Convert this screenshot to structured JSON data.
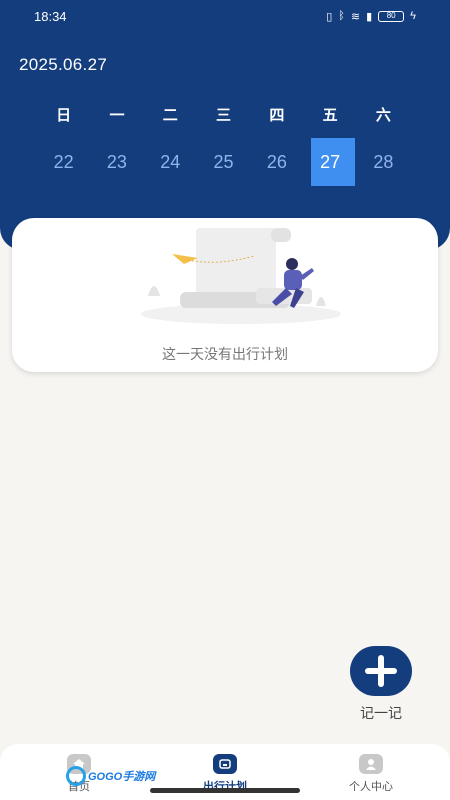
{
  "status_bar": {
    "time": "18:34",
    "battery": "80"
  },
  "header": {
    "date": "2025.06.27",
    "weekdays": [
      "日",
      "一",
      "二",
      "三",
      "四",
      "五",
      "六"
    ],
    "days": [
      "22",
      "23",
      "24",
      "25",
      "26",
      "27",
      "28"
    ],
    "selected_day": "27"
  },
  "card": {
    "empty_text": "这一天没有出行计划"
  },
  "fab": {
    "label": "记一记"
  },
  "tabbar": {
    "tabs": [
      {
        "label": "首页",
        "icon": "home-icon"
      },
      {
        "label": "出行计划",
        "icon": "plan-icon"
      },
      {
        "label": "个人中心",
        "icon": "user-icon"
      }
    ]
  },
  "watermark": {
    "text": "GOGO手游网"
  },
  "colors": {
    "header": "#143d7e",
    "selected": "#3f8ff0",
    "background": "#f6f5f1"
  }
}
